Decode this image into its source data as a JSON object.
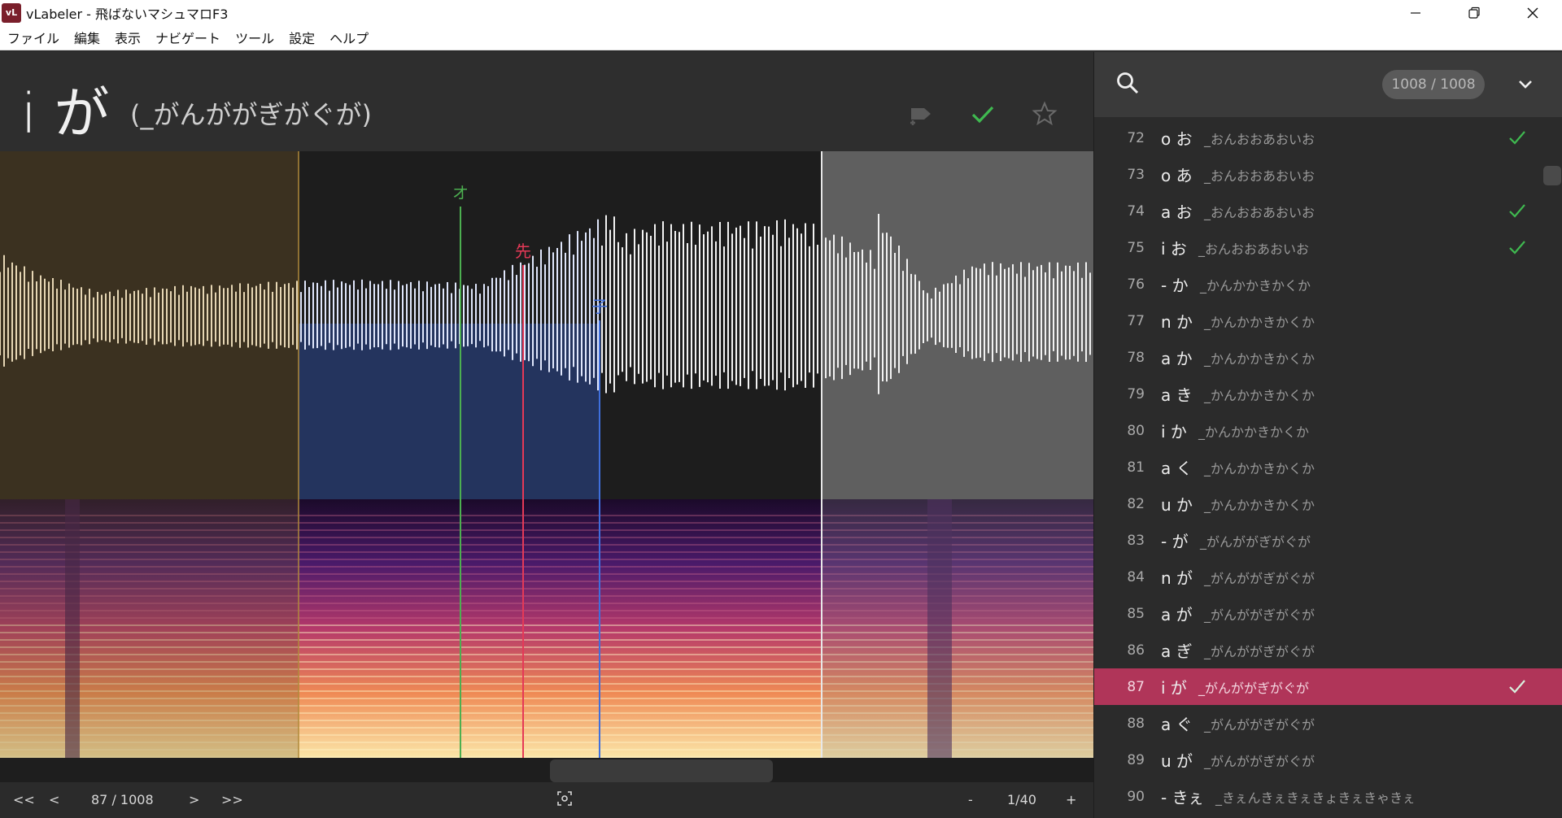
{
  "window": {
    "icon_text": "vL",
    "title": "vLabeler - 飛ばないマシュマロF3",
    "controls": {
      "minimize": "—",
      "maximize": "❐",
      "close": "✕"
    }
  },
  "menu": [
    "ファイル",
    "編集",
    "表示",
    "ナビゲート",
    "ツール",
    "設定",
    "ヘルプ"
  ],
  "entry": {
    "name": "i が",
    "sample": "(_がんががぎがぐが)",
    "done": true,
    "starred": false
  },
  "markers": [
    {
      "label": "オ",
      "color": "#4caf50"
    },
    {
      "label": "先",
      "color": "#e53957"
    },
    {
      "label": "子",
      "color": "#3f6fdd"
    }
  ],
  "bottom": {
    "first": "<<",
    "prev": "<",
    "position": "87 / 1008",
    "next": ">",
    "last": ">>",
    "zoom_out": "-",
    "zoom": "1/40",
    "zoom_in": "+"
  },
  "search": {
    "count": "1008 / 1008"
  },
  "colors": {
    "accent": "#b03559",
    "check": "#3fb950",
    "region_left": "#3b3120",
    "region_right": "#5f5f5f",
    "selection": "#24345e"
  },
  "entries": [
    {
      "num": "72",
      "name": "o お",
      "sample": "_おんおおあおいお",
      "done": true
    },
    {
      "num": "73",
      "name": "o あ",
      "sample": "_おんおおあおいお",
      "done": false
    },
    {
      "num": "74",
      "name": "a お",
      "sample": "_おんおおあおいお",
      "done": true
    },
    {
      "num": "75",
      "name": "i お",
      "sample": "_おんおおあおいお",
      "done": true
    },
    {
      "num": "76",
      "name": "- か",
      "sample": "_かんかかきかくか",
      "done": false
    },
    {
      "num": "77",
      "name": "n か",
      "sample": "_かんかかきかくか",
      "done": false
    },
    {
      "num": "78",
      "name": "a か",
      "sample": "_かんかかきかくか",
      "done": false
    },
    {
      "num": "79",
      "name": "a き",
      "sample": "_かんかかきかくか",
      "done": false
    },
    {
      "num": "80",
      "name": "i か",
      "sample": "_かんかかきかくか",
      "done": false
    },
    {
      "num": "81",
      "name": "a く",
      "sample": "_かんかかきかくか",
      "done": false
    },
    {
      "num": "82",
      "name": "u か",
      "sample": "_かんかかきかくか",
      "done": false
    },
    {
      "num": "83",
      "name": "- が",
      "sample": "_がんががぎがぐが",
      "done": false
    },
    {
      "num": "84",
      "name": "n が",
      "sample": "_がんががぎがぐが",
      "done": false
    },
    {
      "num": "85",
      "name": "a が",
      "sample": "_がんががぎがぐが",
      "done": false
    },
    {
      "num": "86",
      "name": "a ぎ",
      "sample": "_がんががぎがぐが",
      "done": false
    },
    {
      "num": "87",
      "name": "i が",
      "sample": "_がんががぎがぐが",
      "done": true,
      "selected": true
    },
    {
      "num": "88",
      "name": "a ぐ",
      "sample": "_がんががぎがぐが",
      "done": false
    },
    {
      "num": "89",
      "name": "u が",
      "sample": "_がんががぎがぐが",
      "done": false
    },
    {
      "num": "90",
      "name": "- きぇ",
      "sample": "_きぇんきぇきぇきょきぇきゃきぇ",
      "done": false
    }
  ]
}
